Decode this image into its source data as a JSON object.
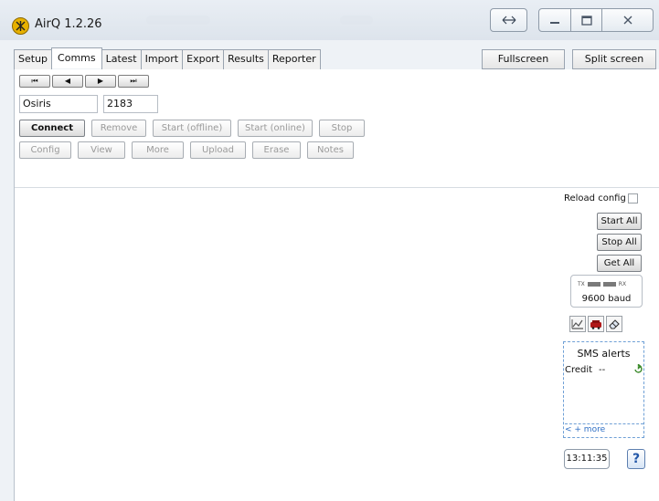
{
  "window": {
    "title": "AirQ 1.2.26"
  },
  "titlebar": {
    "swap_icon": "swap-arrows-icon",
    "minimize_icon": "minimize-icon",
    "maximize_icon": "maximize-icon",
    "close_icon": "close-icon"
  },
  "tabs": [
    {
      "label": "Setup",
      "active": false
    },
    {
      "label": "Comms",
      "active": true
    },
    {
      "label": "Latest",
      "active": false
    },
    {
      "label": "Import",
      "active": false
    },
    {
      "label": "Export",
      "active": false
    },
    {
      "label": "Results",
      "active": false
    },
    {
      "label": "Reporter",
      "active": false
    }
  ],
  "view_buttons": {
    "fullscreen": "Fullscreen",
    "split": "Split screen"
  },
  "nav": {
    "first": "⏮",
    "prev": "◀",
    "next": "▶",
    "last": "⏭"
  },
  "station": {
    "name": "Osiris",
    "id": "2183"
  },
  "actions_row1": {
    "connect": "Connect",
    "remove": "Remove",
    "start_offline": "Start (offline)",
    "start_online": "Start (online)",
    "stop": "Stop"
  },
  "actions_row2": {
    "config": "Config",
    "view": "View",
    "more": "More",
    "upload": "Upload",
    "erase": "Erase",
    "notes": "Notes"
  },
  "side": {
    "reload_config": "Reload config",
    "start_all": "Start All",
    "stop_all": "Stop All",
    "get_all": "Get All",
    "tx": "TX",
    "rx": "RX",
    "baud": "9600 baud"
  },
  "sms": {
    "title": "SMS alerts",
    "credit_label": "Credit",
    "credit_value": "--",
    "more_link": "< + more"
  },
  "status": {
    "clock": "13:11:35",
    "help": "?"
  },
  "colors": {
    "window_bg": "#eef2f6",
    "sms_border": "#6fa0d6",
    "app_icon": "#e7b100"
  }
}
